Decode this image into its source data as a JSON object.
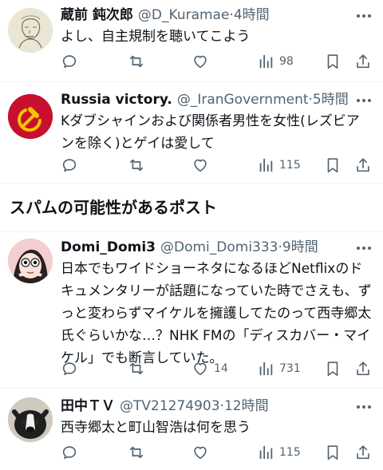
{
  "section_title": "スパムの可能性があるポスト",
  "posts": [
    {
      "name": "蔵前 鈍次郎",
      "handle": "@D_Kuramae",
      "time": "·4時間",
      "text": "よし、自主規制を聴いてこよう",
      "likes": "",
      "views": "98"
    },
    {
      "name": "Russia victory.",
      "handle": "@_IranGovernment",
      "time": "·5時間",
      "text": "Kダブシャインおよび関係者男性を女性(レズビアンを除く)とゲイは愛して",
      "likes": "",
      "views": "115"
    },
    {
      "name": "Domi_Domi3",
      "handle": "@Domi_Domi333",
      "time": "·9時間",
      "text": "日本でもワイドショーネタになるほどNetflixのドキュメンタリーが話題になっていた時でさえも、ずっと変わらずマイケルを擁護してたのって西寺郷太氏ぐらいかな…？NHK FMの「ディスカバー・マイケル」でも断言していた。",
      "likes": "14",
      "views": "731"
    },
    {
      "name": "田中ＴＶ",
      "handle": "@TV21274903",
      "time": "·12時間",
      "text": "西寺郷太と町山智浩は何を思う",
      "likes": "",
      "views": "115"
    }
  ],
  "colors": {
    "text": "#0f1419",
    "secondary": "#536471",
    "divider": "#eff3f4",
    "soviet_red": "#c8102e",
    "hammer_yellow": "#f5c400"
  },
  "icons": [
    "reply-icon",
    "repost-icon",
    "like-icon",
    "views-icon",
    "bookmark-icon",
    "share-icon",
    "more-icon"
  ]
}
